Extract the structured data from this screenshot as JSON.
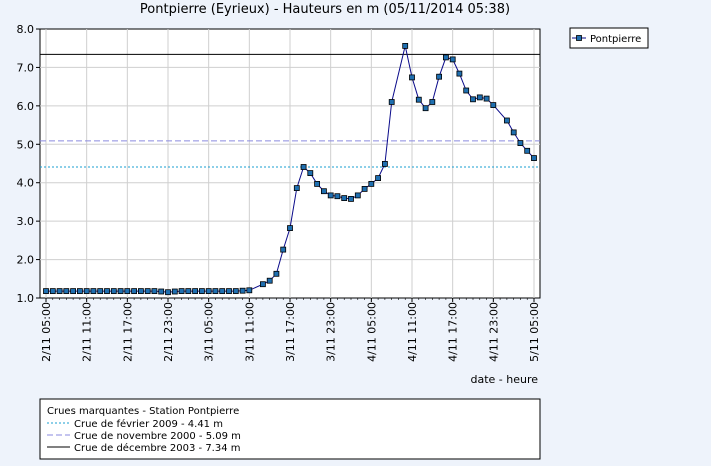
{
  "chart_data": {
    "type": "line",
    "title": "Pontpierre (Eyrieux) - Hauteurs en m (05/11/2014 05:38)",
    "xlabel": "date - heure",
    "ylabel": "",
    "ylim": [
      1.0,
      8.0
    ],
    "yticks": [
      "1.0",
      "2.0",
      "3.0",
      "4.0",
      "5.0",
      "6.0",
      "7.0",
      "8.0"
    ],
    "xticks": [
      "2/11 05:00",
      "2/11 11:00",
      "2/11 17:00",
      "2/11 23:00",
      "3/11 05:00",
      "3/11 11:00",
      "3/11 17:00",
      "3/11 23:00",
      "4/11 05:00",
      "4/11 11:00",
      "4/11 17:00",
      "4/11 23:00",
      "5/11 05:00"
    ],
    "grid": true,
    "legend_position": "top-right",
    "series": [
      {
        "name": "Pontpierre",
        "color": "#0a0a8a",
        "marker_color": "#1f6fb0",
        "x": [
          "02/11 05:00",
          "02/11 06:00",
          "02/11 07:00",
          "02/11 08:00",
          "02/11 09:00",
          "02/11 10:00",
          "02/11 11:00",
          "02/11 12:00",
          "02/11 13:00",
          "02/11 14:00",
          "02/11 15:00",
          "02/11 16:00",
          "02/11 17:00",
          "02/11 18:00",
          "02/11 19:00",
          "02/11 20:00",
          "02/11 21:00",
          "02/11 22:00",
          "02/11 23:00",
          "03/11 00:00",
          "03/11 01:00",
          "03/11 02:00",
          "03/11 03:00",
          "03/11 04:00",
          "03/11 05:00",
          "03/11 06:00",
          "03/11 07:00",
          "03/11 08:00",
          "03/11 09:00",
          "03/11 10:00",
          "03/11 11:00",
          "03/11 13:00",
          "03/11 14:00",
          "03/11 15:00",
          "03/11 16:00",
          "03/11 17:00",
          "03/11 18:00",
          "03/11 19:00",
          "03/11 20:00",
          "03/11 21:00",
          "03/11 22:00",
          "03/11 23:00",
          "04/11 00:00",
          "04/11 01:00",
          "04/11 02:00",
          "04/11 03:00",
          "04/11 04:00",
          "04/11 05:00",
          "04/11 06:00",
          "04/11 07:00",
          "04/11 08:00",
          "04/11 10:00",
          "04/11 11:00",
          "04/11 12:00",
          "04/11 13:00",
          "04/11 14:00",
          "04/11 15:00",
          "04/11 16:00",
          "04/11 17:00",
          "04/11 18:00",
          "04/11 19:00",
          "04/11 20:00",
          "04/11 21:00",
          "04/11 22:00",
          "04/11 23:00",
          "05/11 01:00",
          "05/11 02:00",
          "05/11 03:00",
          "05/11 04:00",
          "05/11 05:00"
        ],
        "values": [
          1.18,
          1.18,
          1.18,
          1.18,
          1.18,
          1.18,
          1.18,
          1.18,
          1.18,
          1.18,
          1.18,
          1.18,
          1.18,
          1.18,
          1.18,
          1.18,
          1.18,
          1.17,
          1.15,
          1.17,
          1.18,
          1.18,
          1.18,
          1.18,
          1.18,
          1.18,
          1.18,
          1.18,
          1.18,
          1.19,
          1.2,
          1.36,
          1.45,
          1.63,
          2.26,
          2.82,
          3.86,
          4.41,
          4.25,
          3.97,
          3.78,
          3.67,
          3.65,
          3.6,
          3.58,
          3.67,
          3.84,
          3.97,
          4.12,
          4.49,
          6.1,
          7.56,
          6.74,
          6.16,
          5.94,
          6.1,
          6.76,
          7.26,
          7.21,
          6.84,
          6.4,
          6.17,
          6.22,
          6.19,
          6.02,
          5.62,
          5.31,
          5.03,
          4.83,
          4.64
        ]
      }
    ],
    "reference_lines": [
      {
        "label": "Crue de février 2009 - 4.41 m",
        "value": 4.41,
        "color": "#1a9fd1",
        "style": "dotted"
      },
      {
        "label": "Crue de novembre 2000 - 5.09 m",
        "value": 5.09,
        "color": "#8a8adf",
        "style": "dashed"
      },
      {
        "label": "Crue de décembre 2003 - 7.34 m",
        "value": 7.34,
        "color": "#000000",
        "style": "solid"
      }
    ],
    "reference_title": "Crues marquantes - Station Pontpierre"
  }
}
